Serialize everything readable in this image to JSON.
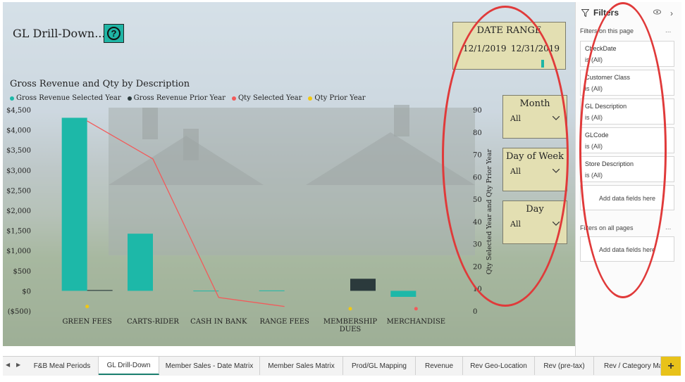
{
  "report": {
    "title": "GL Drill-Down...",
    "help_icon": "question-circle-icon"
  },
  "chart_data": {
    "type": "bar",
    "title": "Gross Revenue and Qty by Description",
    "categories": [
      "GREEN FEES",
      "CARTS-RIDER",
      "CASH IN BANK",
      "RANGE FEES",
      "MEMBERSHIP DUES",
      "MERCHANDISE"
    ],
    "category_lines": [
      [
        "GREEN FEES"
      ],
      [
        "CARTS-RIDER"
      ],
      [
        "CASH IN BANK"
      ],
      [
        "RANGE FEES"
      ],
      [
        "MEMBERSHIP",
        "DUES"
      ],
      [
        "MERCHANDISE"
      ]
    ],
    "series": [
      {
        "name": "Gross Revenue Selected Year",
        "type": "bar",
        "axis": "left",
        "color": "#1db8a8",
        "values": [
          4300,
          1420,
          5,
          10,
          null,
          -150
        ]
      },
      {
        "name": "Gross Revenue Prior Year",
        "type": "bar",
        "axis": "left",
        "color": "#2b3a3c",
        "values": [
          20,
          null,
          null,
          null,
          300,
          null
        ]
      },
      {
        "name": "Qty Selected Year",
        "type": "line",
        "axis": "right",
        "color": "#f25a5a",
        "values": [
          85,
          68,
          6,
          2,
          null,
          null
        ]
      },
      {
        "name": "Qty Prior Year",
        "type": "scatter",
        "axis": "right",
        "color": "#f2c811",
        "values": [
          2,
          null,
          null,
          null,
          1,
          null
        ]
      }
    ],
    "extra_points": [
      {
        "series": "Qty Selected Year",
        "category": "MERCHANDISE",
        "value": 1,
        "color": "#f25a5a"
      }
    ],
    "y_left": {
      "ticks": [
        -500,
        0,
        500,
        1000,
        1500,
        2000,
        2500,
        3000,
        3500,
        4000,
        4500
      ],
      "tick_labels": [
        "($500)",
        "$0",
        "$500",
        "$1,000",
        "$1,500",
        "$2,000",
        "$2,500",
        "$3,000",
        "$3,500",
        "$4,000",
        "$4,500"
      ],
      "ylim": [
        -500,
        4500
      ]
    },
    "y_right": {
      "label": "Qty Selected Year and Qty Prior Year",
      "ticks": [
        0,
        10,
        20,
        30,
        40,
        50,
        60,
        70,
        80,
        90
      ],
      "ylim": [
        0,
        90
      ]
    },
    "legend_position": "top-left",
    "grid": false
  },
  "slicers": {
    "date_range": {
      "title": "DATE RANGE",
      "start": "12/1/2019",
      "end": "12/31/2019"
    },
    "month": {
      "title": "Month",
      "value": "All",
      "icon": "chevron-down-icon"
    },
    "day_of_week": {
      "title": "Day of Week",
      "value": "All",
      "icon": "chevron-down-icon"
    },
    "day": {
      "title": "Day",
      "value": "All",
      "icon": "chevron-down-icon"
    }
  },
  "filters": {
    "title": "Filters",
    "icon": "funnel-icon",
    "page_section": "Filters on this page",
    "all_pages_section": "Filters on all pages",
    "more": "...",
    "cards": [
      {
        "name": "CheckDate",
        "value": "is (All)"
      },
      {
        "name": "Customer Class",
        "value": "is (All)"
      },
      {
        "name": "GL Description",
        "value": "is (All)"
      },
      {
        "name": "GLCode",
        "value": "is (All)"
      },
      {
        "name": "Store Description",
        "value": "is (All)"
      }
    ],
    "add_fields": "Add data fields here"
  },
  "tabs": {
    "items": [
      "F&B Meal Periods",
      "GL Drill-Down",
      "Member Sales - Date Matrix",
      "Member Sales Matrix",
      "Prod/GL Mapping",
      "Revenue",
      "Rev Geo-Location",
      "Rev (pre-tax)",
      "Rev / Category Mat"
    ],
    "active": "GL Drill-Down",
    "add": "+"
  },
  "colors": {
    "annotation": "#e03a3a",
    "accent": "#1fb5a5",
    "slicer_bg": "#e3dfb2"
  }
}
